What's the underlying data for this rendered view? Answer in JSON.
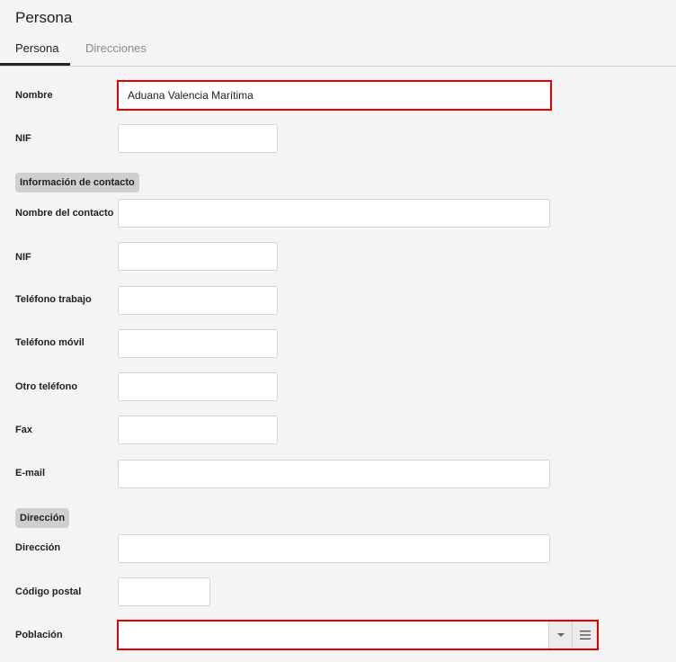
{
  "page": {
    "title": "Persona"
  },
  "tabs": [
    {
      "label": "Persona",
      "active": true
    },
    {
      "label": "Direcciones",
      "active": false
    }
  ],
  "form": {
    "nombre": {
      "label": "Nombre",
      "value": "Aduana Valencia Marítima"
    },
    "nif": {
      "label": "NIF",
      "value": ""
    },
    "contact_section": "Información de contacto",
    "nombre_contacto": {
      "label": "Nombre del contacto",
      "value": ""
    },
    "contacto_nif": {
      "label": "NIF",
      "value": ""
    },
    "telefono_trabajo": {
      "label": "Teléfono trabajo",
      "value": ""
    },
    "telefono_movil": {
      "label": "Teléfono móvil",
      "value": ""
    },
    "otro_telefono": {
      "label": "Otro teléfono",
      "value": ""
    },
    "fax": {
      "label": "Fax",
      "value": ""
    },
    "email": {
      "label": "E-mail",
      "value": ""
    },
    "address_section": "Dirección",
    "direccion": {
      "label": "Dirección",
      "value": ""
    },
    "codigo_postal": {
      "label": "Código postal",
      "value": ""
    },
    "poblacion": {
      "label": "Población",
      "value": ""
    }
  },
  "icons": {
    "dropdown": "caret-down-icon",
    "list": "list-icon"
  },
  "colors": {
    "highlight": "#e00000",
    "section_bg": "#cfcfcf",
    "page_bg": "#f4f4f4"
  }
}
